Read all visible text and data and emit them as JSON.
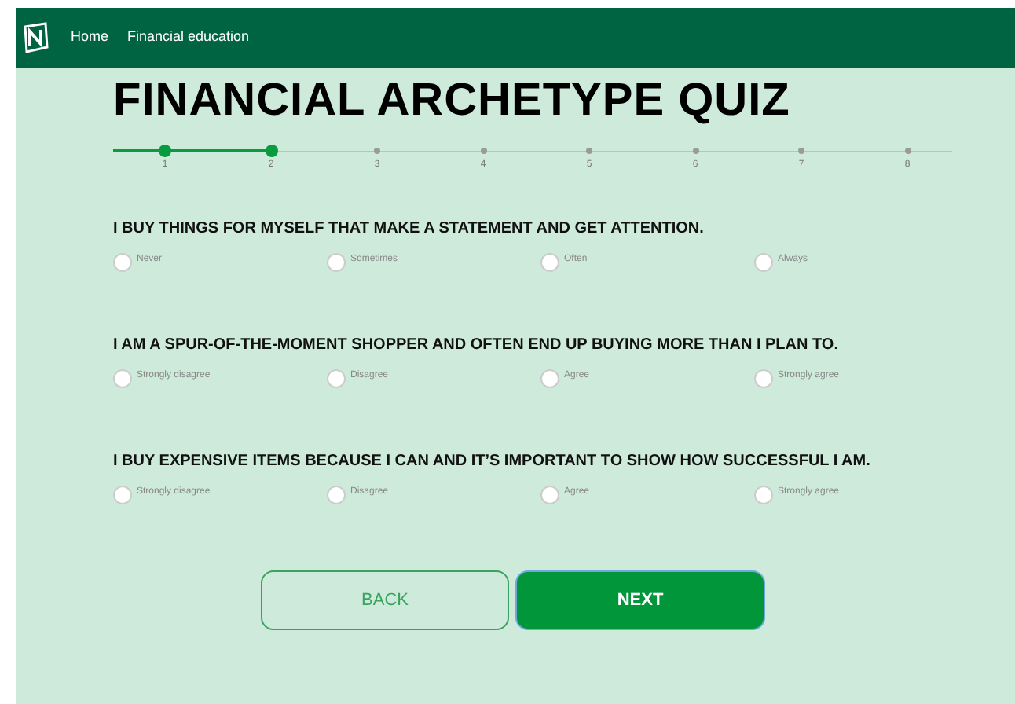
{
  "nav": {
    "links": [
      "Home",
      "Financial education"
    ]
  },
  "title": "FINANCIAL ARCHETYPE QUIZ",
  "steps": [
    {
      "label": "1",
      "done": true
    },
    {
      "label": "2",
      "done": true
    },
    {
      "label": "3",
      "done": false
    },
    {
      "label": "4",
      "done": false
    },
    {
      "label": "5",
      "done": false
    },
    {
      "label": "6",
      "done": false
    },
    {
      "label": "7",
      "done": false
    },
    {
      "label": "8",
      "done": false
    }
  ],
  "questions": [
    {
      "text": "I BUY THINGS FOR MYSELF THAT MAKE A STATEMENT AND GET ATTENTION.",
      "options": [
        {
          "label": "Never",
          "selected": false
        },
        {
          "label": "Sometimes",
          "selected": false
        },
        {
          "label": "Often",
          "selected": false
        },
        {
          "label": "Always",
          "selected": false
        }
      ]
    },
    {
      "text": "I AM A SPUR-OF-THE-MOMENT SHOPPER AND OFTEN END UP BUYING MORE THAN I PLAN TO.",
      "options": [
        {
          "label": "Strongly disagree",
          "selected": false
        },
        {
          "label": "Disagree",
          "selected": false
        },
        {
          "label": "Agree",
          "selected": false
        },
        {
          "label": "Strongly agree",
          "selected": false
        }
      ]
    },
    {
      "text": "I BUY EXPENSIVE ITEMS BECAUSE I CAN AND IT’S IMPORTANT TO SHOW HOW SUCCESSFUL I AM.",
      "options": [
        {
          "label": "Strongly disagree",
          "selected": false
        },
        {
          "label": "Disagree",
          "selected": false
        },
        {
          "label": "Agree",
          "selected": false
        },
        {
          "label": "Strongly agree",
          "selected": false
        }
      ]
    }
  ],
  "buttons": {
    "back": "BACK",
    "next": "NEXT"
  }
}
